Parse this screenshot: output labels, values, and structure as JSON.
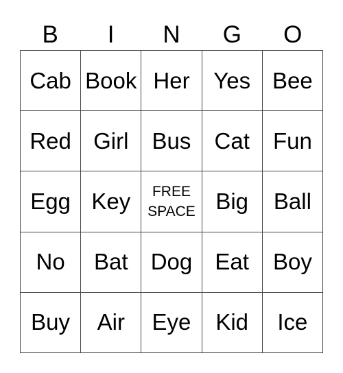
{
  "header": [
    "B",
    "I",
    "N",
    "G",
    "O"
  ],
  "cells": [
    "Cab",
    "Book",
    "Her",
    "Yes",
    "Bee",
    "Red",
    "Girl",
    "Bus",
    "Cat",
    "Fun",
    "Egg",
    "Key",
    "FREE SPACE",
    "Big",
    "Ball",
    "No",
    "Bat",
    "Dog",
    "Eat",
    "Boy",
    "Buy",
    "Air",
    "Eye",
    "Kid",
    "Ice"
  ],
  "free_index": 12
}
